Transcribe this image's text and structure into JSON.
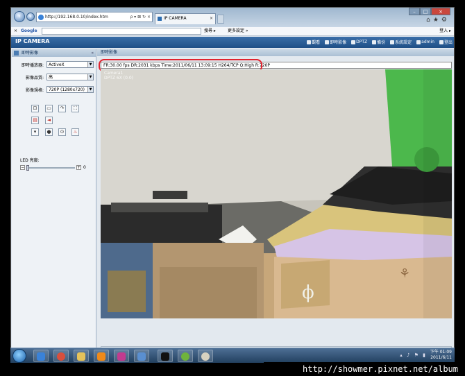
{
  "browser": {
    "address": "http://192.168.0.10/index.htm",
    "address_tools": "ρ ▾ ⊠ ↻ ×",
    "tab_title": "IP CAMERA",
    "tab_close": "×"
  },
  "google_bar": {
    "close": "×",
    "logo": "Google",
    "search_label": "搜尋 ▸",
    "more_label": "更多設定 »",
    "login_label": "登入 ▸"
  },
  "app": {
    "title": "IP CAMERA",
    "menu": [
      "觀看",
      "即時影像",
      "DPTZ",
      "備份",
      "系統設定",
      "admin",
      "登出"
    ]
  },
  "left_panel": {
    "title": "即時影像",
    "collapse": "«",
    "player_label": "即時播放器:",
    "player_value": "ActiveX",
    "quality_label": "影像品質:",
    "quality_value": "高",
    "res_label": "影像規格:",
    "res_value": "720P (1280x720)",
    "led_label": "LED 亮度:",
    "led_value": "0",
    "led_level_fraction": 0.0
  },
  "main": {
    "title": "即時影像",
    "status_text": "FR:30.00 fps  DR:2031 kbps Time:2011/06/11 13:09:15 H264/TCP Q:High R:720P",
    "osd_line1": "Camera1",
    "osd_line2": "DPTZ 6X (0.0)"
  },
  "taskbar": {
    "time": "下午 01:09",
    "date": "2011/6/11"
  },
  "watermark": "http://showmer.pixnet.net/album",
  "colors": {
    "app_header": "#1f4f86",
    "highlight_box": "#e0232f",
    "taskbar": "#22405f"
  }
}
